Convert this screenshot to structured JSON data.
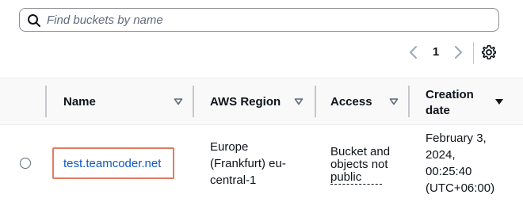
{
  "search": {
    "placeholder": "Find buckets by name",
    "value": ""
  },
  "pagination": {
    "current_page": "1"
  },
  "table": {
    "columns": [
      {
        "label": "Name"
      },
      {
        "label": "AWS Region"
      },
      {
        "label": "Access"
      },
      {
        "label_line1": "Creation",
        "label_line2": "date"
      }
    ],
    "rows": [
      {
        "name": "test.teamcoder.net",
        "region_line1": "Europe",
        "region_line2": "(Frankfurt) eu-",
        "region_line3": "central-1",
        "access_line1": "Bucket and",
        "access_line2": "objects not",
        "access_line3": "public",
        "created_line1": "February 3,",
        "created_line2": "2024,",
        "created_line3": "00:25:40",
        "created_line4": "(UTC+06:00)"
      }
    ]
  },
  "icons": {
    "search": "search-icon",
    "prev": "chevron-left-icon",
    "next": "chevron-right-icon",
    "settings": "gear-icon",
    "sort": "caret-down-icon",
    "sort_active": "caret-down-filled-icon"
  }
}
